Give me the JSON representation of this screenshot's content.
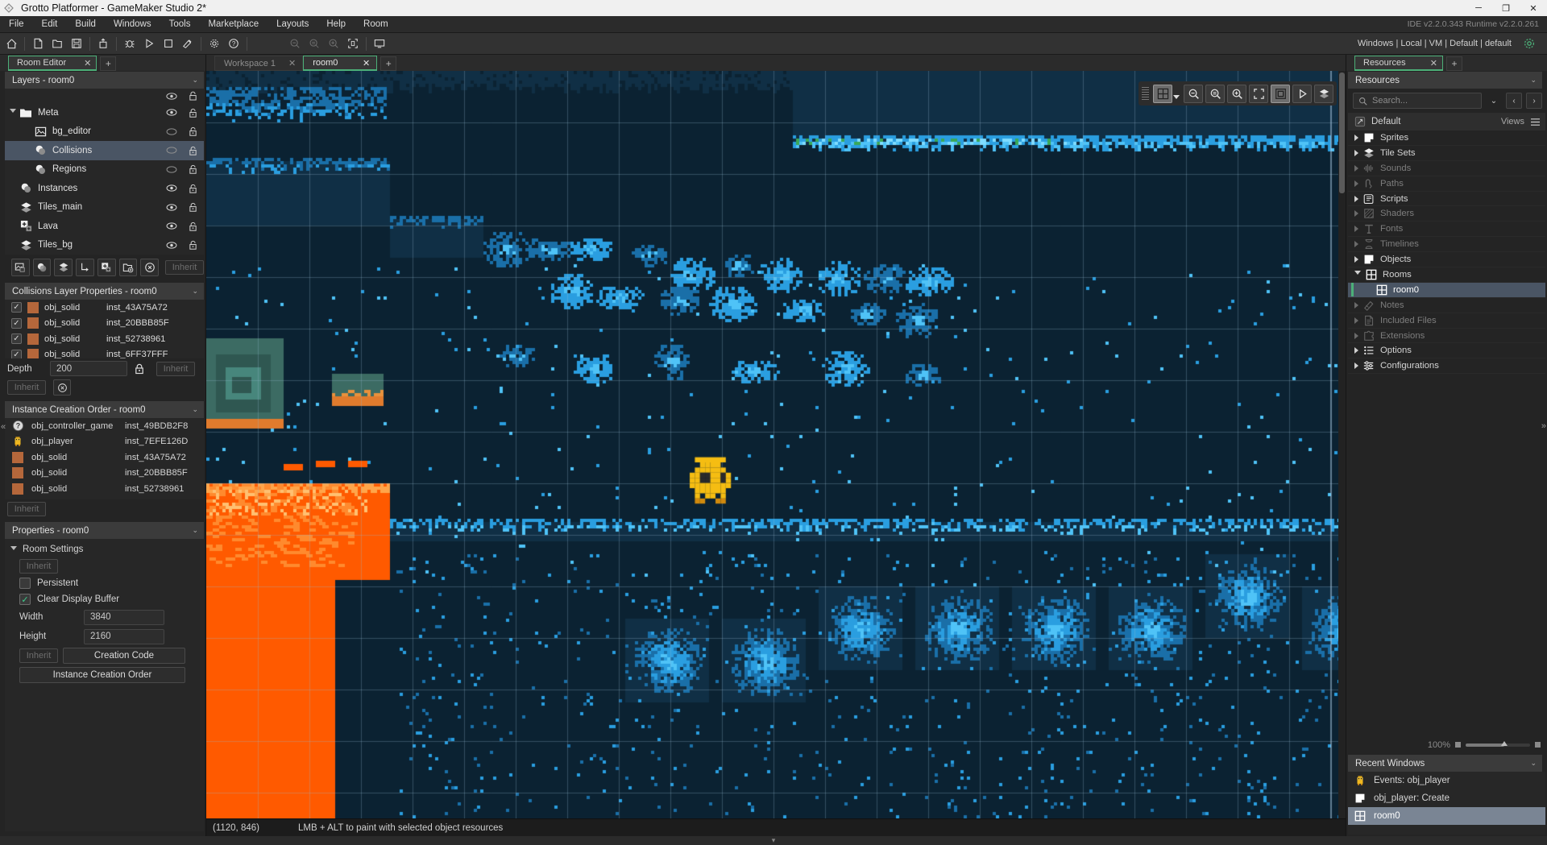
{
  "window": {
    "title": "Grotto Platformer - GameMaker Studio 2*",
    "minimize": "─",
    "maximize": "❐",
    "close": "✕"
  },
  "menu": {
    "items": [
      "File",
      "Edit",
      "Build",
      "Windows",
      "Tools",
      "Marketplace",
      "Layouts",
      "Help",
      "Room"
    ],
    "ide_info": "IDE v2.2.0.343 Runtime v2.2.0.261"
  },
  "toolbar": {
    "target": "Windows | Local | VM | Default | default",
    "buttons": [
      "home-icon",
      "new-file-icon",
      "open-folder-icon",
      "save-icon",
      "upload-icon",
      "debug-icon",
      "play-icon",
      "stop-icon",
      "clean-icon",
      "gear-icon",
      "help-icon",
      "zoom-out-icon",
      "zoom-reset-icon",
      "zoom-in-icon",
      "zoom-fit-icon",
      "monitor-icon"
    ],
    "settings_icon": "gear-icon"
  },
  "left_panel": {
    "tab": {
      "label": "Room Editor",
      "close": "✕",
      "add": "+"
    },
    "layers": {
      "title": "Layers - room0",
      "chevron": "⌄",
      "rows": [
        {
          "name": "Meta",
          "icon": "folder-icon",
          "indent": 0,
          "expander": "open",
          "selected": false,
          "eye": true,
          "lock": true,
          "controls": "eye-lock"
        },
        {
          "name": "bg_editor",
          "icon": "image-icon",
          "indent": 1,
          "expander": "none",
          "selected": false,
          "eye": false,
          "lock": true,
          "controls": "circle-lock"
        },
        {
          "name": "Collisions",
          "icon": "instance-icon",
          "indent": 1,
          "expander": "none",
          "selected": true,
          "eye": false,
          "lock": true,
          "controls": "circle-lock"
        },
        {
          "name": "Regions",
          "icon": "instance-icon",
          "indent": 1,
          "expander": "none",
          "selected": false,
          "eye": false,
          "lock": true,
          "controls": "circle-lock"
        },
        {
          "name": "Instances",
          "icon": "instance-icon",
          "indent": 0,
          "expander": "none",
          "selected": false,
          "eye": true,
          "lock": true,
          "controls": "eye-lock"
        },
        {
          "name": "Tiles_main",
          "icon": "tiles-icon",
          "indent": 0,
          "expander": "none",
          "selected": false,
          "eye": true,
          "lock": true,
          "controls": "eye-lock"
        },
        {
          "name": "Lava",
          "icon": "asset-icon",
          "indent": 0,
          "expander": "none",
          "selected": false,
          "eye": true,
          "lock": true,
          "controls": "eye-lock"
        },
        {
          "name": "Tiles_bg",
          "icon": "tiles-icon",
          "indent": 0,
          "expander": "none",
          "selected": false,
          "eye": true,
          "lock": true,
          "controls": "eye-lock"
        }
      ],
      "toolbar_buttons": [
        "add-background-layer-icon",
        "add-instance-layer-icon",
        "add-tile-layer-icon",
        "add-path-layer-icon",
        "add-asset-layer-icon",
        "add-folder-icon",
        "delete-layer-icon"
      ],
      "inherit_label": "Inherit"
    },
    "layer_properties": {
      "title": "Collisions Layer Properties - room0",
      "chevron": "⌄",
      "instances": [
        {
          "object": "obj_solid",
          "inst": "inst_43A75A72",
          "checked": true
        },
        {
          "object": "obj_solid",
          "inst": "inst_20BBB85F",
          "checked": true
        },
        {
          "object": "obj_solid",
          "inst": "inst_52738961",
          "checked": true
        },
        {
          "object": "obj_solid",
          "inst": "inst_6FF37FFF",
          "checked": true
        }
      ],
      "depth_label": "Depth",
      "depth_value": "200",
      "lock_icon": "lock-icon",
      "inherit_right_label": "Inherit",
      "inherit_label": "Inherit",
      "clear_icon": "clear-icon"
    },
    "creation_order": {
      "title": "Instance Creation Order - room0",
      "chevron": "⌄",
      "rows": [
        {
          "object": "obj_controller_game",
          "inst": "inst_49BDB2F8",
          "icon": "question-icon"
        },
        {
          "object": "obj_player",
          "inst": "inst_7EFE126D",
          "icon": "player-icon"
        },
        {
          "object": "obj_solid",
          "inst": "inst_43A75A72",
          "icon": "solid-icon"
        },
        {
          "object": "obj_solid",
          "inst": "inst_20BBB85F",
          "icon": "solid-icon"
        },
        {
          "object": "obj_solid",
          "inst": "inst_52738961",
          "icon": "solid-icon"
        }
      ],
      "inherit_label": "Inherit"
    },
    "properties": {
      "title": "Properties - room0",
      "chevron": "⌄",
      "group": "Room Settings",
      "inherit_label": "Inherit",
      "persistent_label": "Persistent",
      "persistent_checked": false,
      "clear_display_label": "Clear Display Buffer",
      "clear_display_checked": true,
      "width_label": "Width",
      "width_value": "3840",
      "height_label": "Height",
      "height_value": "2160",
      "creation_code_label": "Creation Code",
      "instance_creation_order_label": "Instance Creation Order"
    },
    "collapse_icon": "«"
  },
  "center": {
    "tabs": [
      {
        "label": "Workspace 1",
        "active": false,
        "close": "✕"
      },
      {
        "label": "room0",
        "active": true,
        "close": "✕"
      }
    ],
    "add_tab": "+",
    "float_toolbar": [
      {
        "name": "grid-toggle-icon",
        "active": true
      },
      {
        "name": "grid-dropdown-icon",
        "active": true
      },
      {
        "name": "zoom-out-icon",
        "active": false
      },
      {
        "name": "zoom-reset-icon",
        "active": false
      },
      {
        "name": "zoom-in-icon",
        "active": false
      },
      {
        "name": "zoom-fit-icon",
        "active": false
      },
      {
        "name": "view-bounds-icon",
        "active": true
      },
      {
        "name": "play-room-icon",
        "active": false
      },
      {
        "name": "tileset-icon",
        "active": false
      }
    ],
    "status": {
      "coords": "(1120, 846)",
      "hint": "LMB + ALT to paint with selected object resources"
    }
  },
  "right_panel": {
    "tab": {
      "label": "Resources",
      "close": "✕",
      "add": "+"
    },
    "header": {
      "title": "Resources",
      "chevron": "⌄"
    },
    "search": {
      "placeholder": "Search...",
      "icon": "search-icon",
      "dropdown": "⌄",
      "prev": "‹",
      "next": "›"
    },
    "default_row": {
      "label": "Default",
      "views": "Views",
      "menu_icon": "hamburger-icon"
    },
    "tree": [
      {
        "label": "Sprites",
        "icon": "sprite-icon",
        "expander": "closed",
        "dim": false,
        "indent": 0,
        "selected": false
      },
      {
        "label": "Tile Sets",
        "icon": "tileset-icon",
        "expander": "closed",
        "dim": false,
        "indent": 0,
        "selected": false
      },
      {
        "label": "Sounds",
        "icon": "sound-icon",
        "expander": "closed",
        "dim": true,
        "indent": 0,
        "selected": false
      },
      {
        "label": "Paths",
        "icon": "path-icon",
        "expander": "closed",
        "dim": true,
        "indent": 0,
        "selected": false
      },
      {
        "label": "Scripts",
        "icon": "script-icon",
        "expander": "closed",
        "dim": false,
        "indent": 0,
        "selected": false
      },
      {
        "label": "Shaders",
        "icon": "shader-icon",
        "expander": "closed",
        "dim": true,
        "indent": 0,
        "selected": false
      },
      {
        "label": "Fonts",
        "icon": "font-icon",
        "expander": "closed",
        "dim": true,
        "indent": 0,
        "selected": false
      },
      {
        "label": "Timelines",
        "icon": "timeline-icon",
        "expander": "closed",
        "dim": true,
        "indent": 0,
        "selected": false
      },
      {
        "label": "Objects",
        "icon": "object-icon",
        "expander": "closed",
        "dim": false,
        "indent": 0,
        "selected": false
      },
      {
        "label": "Rooms",
        "icon": "room-icon",
        "expander": "open",
        "dim": false,
        "indent": 0,
        "selected": false
      },
      {
        "label": "room0",
        "icon": "room-icon",
        "expander": "none",
        "dim": false,
        "indent": 1,
        "selected": true
      },
      {
        "label": "Notes",
        "icon": "note-icon",
        "expander": "closed",
        "dim": true,
        "indent": 0,
        "selected": false
      },
      {
        "label": "Included Files",
        "icon": "file-icon",
        "expander": "closed",
        "dim": true,
        "indent": 0,
        "selected": false
      },
      {
        "label": "Extensions",
        "icon": "extension-icon",
        "expander": "closed",
        "dim": true,
        "indent": 0,
        "selected": false
      },
      {
        "label": "Options",
        "icon": "options-icon",
        "expander": "closed",
        "dim": false,
        "indent": 0,
        "selected": false
      },
      {
        "label": "Configurations",
        "icon": "config-icon",
        "expander": "closed",
        "dim": false,
        "indent": 0,
        "selected": false
      }
    ],
    "zoom": {
      "value": "100%"
    },
    "recent_windows": {
      "title": "Recent Windows",
      "chevron": "⌄",
      "rows": [
        {
          "label": "Events: obj_player",
          "icon": "player-icon",
          "selected": false
        },
        {
          "label": "obj_player: Create",
          "icon": "object-icon",
          "selected": false
        },
        {
          "label": "room0",
          "icon": "room-icon",
          "selected": true
        }
      ]
    },
    "expand_icon": "»"
  },
  "colors": {
    "accent_green": "#4CAF78",
    "selection_blue": "#4a5564",
    "panel_bg": "#242424",
    "canvas_bg": "#0c2030",
    "lava_orange": "#FF5A00",
    "solid_swatch": "#b5673b"
  }
}
